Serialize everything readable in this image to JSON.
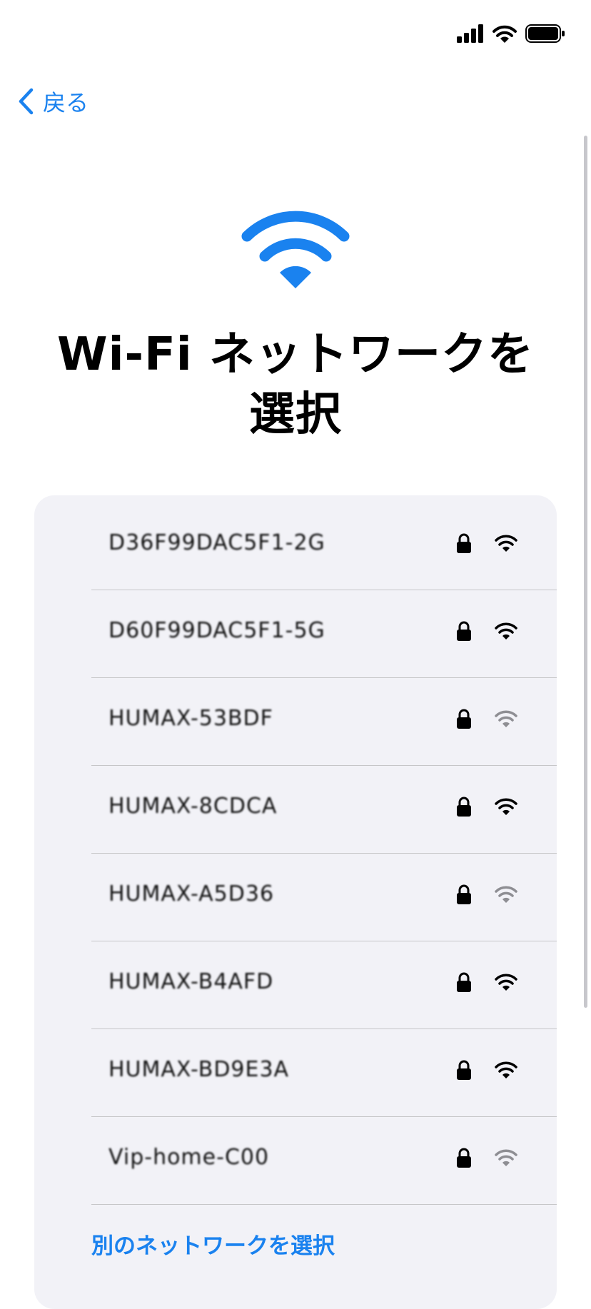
{
  "status_bar": {
    "icons": [
      "cellular-signal-icon",
      "wifi-icon",
      "battery-icon"
    ]
  },
  "nav": {
    "back_label": "戻る",
    "back_icon": "chevron-left-icon"
  },
  "hero": {
    "icon": "wifi-icon",
    "title": "Wi-Fi ネットワークを選択"
  },
  "networks": [
    {
      "name": "D36F99DAC5F1-2G",
      "secured": true,
      "signal": "strong"
    },
    {
      "name": "D60F99DAC5F1-5G",
      "secured": true,
      "signal": "strong"
    },
    {
      "name": "HUMAX-53BDF",
      "secured": true,
      "signal": "weak"
    },
    {
      "name": "HUMAX-8CDCA",
      "secured": true,
      "signal": "strong"
    },
    {
      "name": "HUMAX-A5D36",
      "secured": true,
      "signal": "weak"
    },
    {
      "name": "HUMAX-B4AFD",
      "secured": true,
      "signal": "strong"
    },
    {
      "name": "HUMAX-BD9E3A",
      "secured": true,
      "signal": "strong"
    },
    {
      "name": "Vip-home-C00",
      "secured": true,
      "signal": "weak"
    }
  ],
  "other_network_label": "別のネットワークを選択",
  "colors": {
    "accent": "#1a82ef",
    "card_background": "#f2f2f7",
    "separator": "#c6c6c8",
    "signal_weak": "#8e8e93"
  }
}
